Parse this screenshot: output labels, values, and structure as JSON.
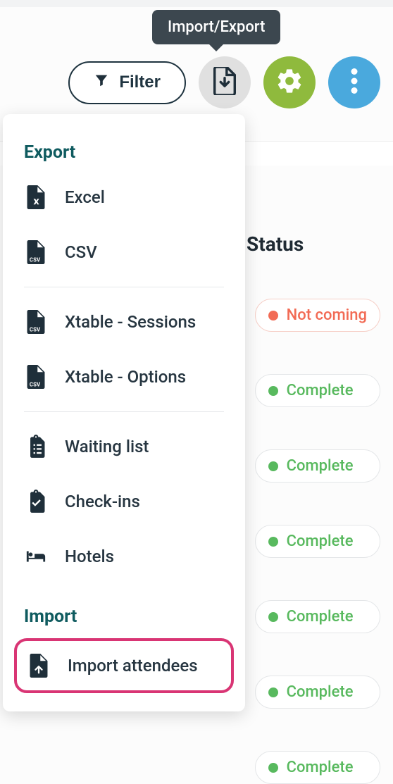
{
  "tooltip": {
    "label": "Import/Export"
  },
  "toolbar": {
    "filter_label": "Filter"
  },
  "table": {
    "status_header": "Status",
    "rows": [
      {
        "status": "Not coming",
        "kind": "notcoming"
      },
      {
        "status": "Complete",
        "kind": "complete"
      },
      {
        "status": "Complete",
        "kind": "complete"
      },
      {
        "status": "Complete",
        "kind": "complete"
      },
      {
        "status": "Complete",
        "kind": "complete"
      },
      {
        "status": "Complete",
        "kind": "complete"
      },
      {
        "status": "Complete",
        "kind": "complete"
      }
    ]
  },
  "dropdown": {
    "export_title": "Export",
    "import_title": "Import",
    "excel": "Excel",
    "csv": "CSV",
    "xtable_sessions": "Xtable - Sessions",
    "xtable_options": "Xtable - Options",
    "waiting_list": "Waiting list",
    "checkins": "Check-ins",
    "hotels": "Hotels",
    "import_attendees": "Import attendees"
  }
}
